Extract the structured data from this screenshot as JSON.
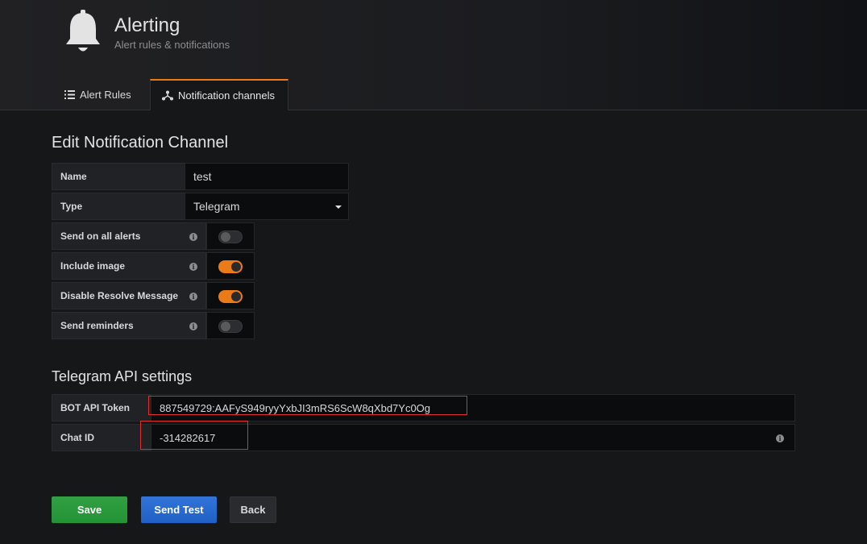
{
  "header": {
    "title": "Alerting",
    "subtitle": "Alert rules & notifications",
    "icon": "bell-icon"
  },
  "tabs": [
    {
      "label": "Alert Rules",
      "icon": "list-icon",
      "active": false
    },
    {
      "label": "Notification channels",
      "icon": "channels-icon",
      "active": true
    }
  ],
  "form": {
    "title": "Edit Notification Channel",
    "name": {
      "label": "Name",
      "value": "test"
    },
    "type": {
      "label": "Type",
      "value": "Telegram"
    },
    "toggles": [
      {
        "label": "Send on all alerts",
        "on": false
      },
      {
        "label": "Include image",
        "on": true
      },
      {
        "label": "Disable Resolve Message",
        "on": true
      },
      {
        "label": "Send reminders",
        "on": false
      }
    ]
  },
  "telegram": {
    "title": "Telegram API settings",
    "bot_token": {
      "label": "BOT API Token",
      "value": "887549729:AAFyS949ryyYxbJI3mRS6ScW8qXbd7Yc0Og"
    },
    "chat_id": {
      "label": "Chat ID",
      "value": "-314282617"
    }
  },
  "buttons": {
    "save": "Save",
    "send_test": "Send Test",
    "back": "Back"
  },
  "colors": {
    "accent": "#eb7b18",
    "save": "#299c3d",
    "send_test": "#2a6bd0",
    "highlight": "#e02f2f"
  }
}
